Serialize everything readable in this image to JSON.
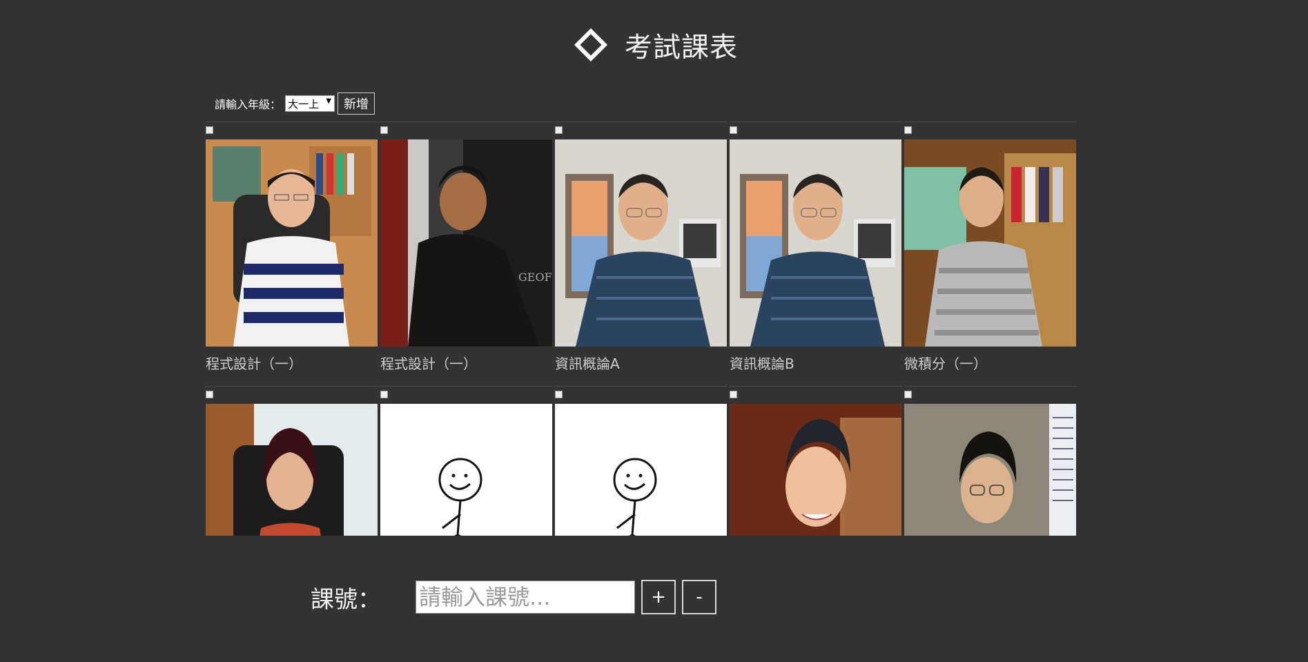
{
  "header": {
    "title": "考試課表",
    "icon": "diamond-icon"
  },
  "grade": {
    "label": "請輸入年級：",
    "selected": "大一上",
    "add_label": "新增"
  },
  "courses": [
    {
      "name": "程式設計（一）",
      "photo": "teacher-photo"
    },
    {
      "name": "程式設計（一）",
      "photo": "teacher-photo"
    },
    {
      "name": "資訊概論A",
      "photo": "teacher-photo"
    },
    {
      "name": "資訊概論B",
      "photo": "teacher-photo"
    },
    {
      "name": "微積分（一）",
      "photo": "teacher-photo"
    },
    {
      "name": "",
      "photo": "teacher-photo"
    },
    {
      "name": "",
      "photo": "stick-figure"
    },
    {
      "name": "",
      "photo": "stick-figure"
    },
    {
      "name": "",
      "photo": "teacher-photo"
    },
    {
      "name": "",
      "photo": "teacher-photo"
    }
  ],
  "course_input": {
    "label": "課號：",
    "placeholder": "請輸入課號...",
    "plus": "+",
    "minus": "-"
  }
}
